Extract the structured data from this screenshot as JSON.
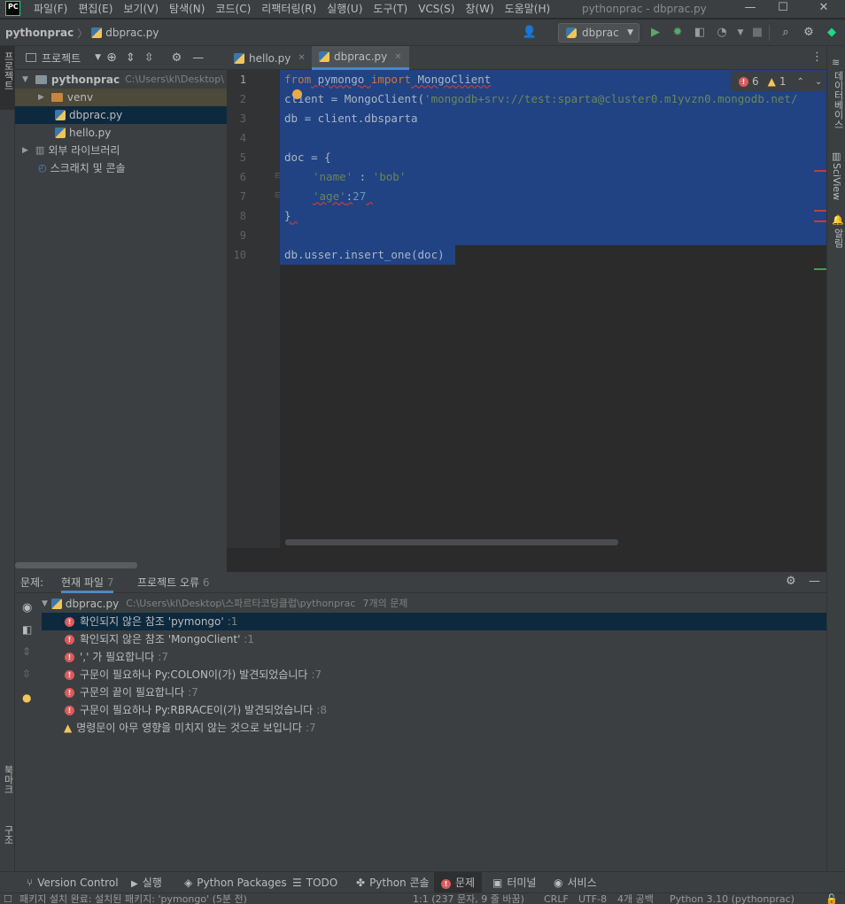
{
  "app": {
    "logo": "PC",
    "window_title": "pythonprac - dbprac.py"
  },
  "menu": [
    "파일(F)",
    "편집(E)",
    "보기(V)",
    "탐색(N)",
    "코드(C)",
    "리팩터링(R)",
    "실행(U)",
    "도구(T)",
    "VCS(S)",
    "창(W)",
    "도움말(H)"
  ],
  "navbar": {
    "project": "pythonprac",
    "file": "dbprac.py",
    "run_config": "dbprac"
  },
  "left_strip": {
    "project": "프로젝트",
    "bookmarks": "북마크",
    "structure": "구조"
  },
  "right_strip": {
    "database": "데이터베이스",
    "sciview": "SciView",
    "notifications": "알림"
  },
  "project_panel": {
    "title": "프로젝트",
    "root": "pythonprac",
    "root_path": "C:\\Users\\kl\\Desktop\\",
    "items": [
      {
        "label": "venv"
      },
      {
        "label": "dbprac.py"
      },
      {
        "label": "hello.py"
      },
      {
        "label": "외부 라이브러리"
      },
      {
        "label": "스크래치 및 콘솔"
      }
    ]
  },
  "editor": {
    "tabs": [
      {
        "label": "hello.py"
      },
      {
        "label": "dbprac.py"
      }
    ],
    "line_numbers": [
      "1",
      "2",
      "3",
      "4",
      "5",
      "6",
      "7",
      "8",
      "9",
      "10"
    ],
    "errors": "6",
    "warnings": "1",
    "code": {
      "l1_kw1": "from",
      "l1_mod": " pymongo ",
      "l1_kw2": "import",
      "l1_cls": " MongoClient",
      "l2_a": "client = MongoClient(",
      "l2_str": "'mongodb+srv://test:sparta@cluster0.m1yvzn0.mongodb.net/",
      "l3": "db = client.dbsparta",
      "l5": "doc = {",
      "l6_str1": "'name'",
      "l6_mid": " : ",
      "l6_str2": "'bob'",
      "l7_str": "'age'",
      "l7_colon": ":",
      "l7_num": "27",
      "l8": "}",
      "l10": "db.usser.insert_one(doc)"
    }
  },
  "problems": {
    "label": "문제:",
    "tabs": [
      {
        "label": "현재 파일",
        "count": "7"
      },
      {
        "label": "프로젝트 오류",
        "count": "6"
      }
    ],
    "file": "dbprac.py",
    "file_path": "C:\\Users\\kl\\Desktop\\스파르타코딩클럽\\pythonprac",
    "file_summary": "7개의 문제",
    "items": [
      {
        "text": "확인되지 않은 참조 'pymongo'",
        "loc": ":1",
        "level": "error"
      },
      {
        "text": "확인되지 않은 참조 'MongoClient'",
        "loc": ":1",
        "level": "error"
      },
      {
        "text": "',' 가 필요합니다",
        "loc": ":7",
        "level": "error"
      },
      {
        "text": "구문이 필요하나 Py:COLON이(가) 발견되었습니다",
        "loc": ":7",
        "level": "error"
      },
      {
        "text": "구문의 끝이 필요합니다",
        "loc": ":7",
        "level": "error"
      },
      {
        "text": "구문이 필요하나 Py:RBRACE이(가) 발견되었습니다",
        "loc": ":8",
        "level": "error"
      },
      {
        "text": "명령문이 아무 영향을 미치지 않는 것으로 보입니다",
        "loc": ":7",
        "level": "warning"
      }
    ]
  },
  "bottom_tools": [
    {
      "label": "Version Control",
      "icon": "branch-icon"
    },
    {
      "label": "실행",
      "icon": "play-icon"
    },
    {
      "label": "Python Packages",
      "icon": "layers-icon"
    },
    {
      "label": "TODO",
      "icon": "list-icon"
    },
    {
      "label": "Python 콘솔",
      "icon": "python-icon"
    },
    {
      "label": "문제",
      "icon": "error-icon"
    },
    {
      "label": "터미널",
      "icon": "terminal-icon"
    },
    {
      "label": "서비스",
      "icon": "services-icon"
    }
  ],
  "status": {
    "message": "패키지 설치 완료: 설치된 패키지: 'pymongo' (5분 전)",
    "position": "1:1 (237 문자, 9 줄 바꿈)",
    "line_sep": "CRLF",
    "encoding": "UTF-8",
    "indent": "4개 공백",
    "interpreter": "Python 3.10 (pythonprac)"
  },
  "colors": {
    "selection": "#214283",
    "error": "#db5c5c",
    "warning": "#f2c55c",
    "accent": "#4a88c7"
  }
}
